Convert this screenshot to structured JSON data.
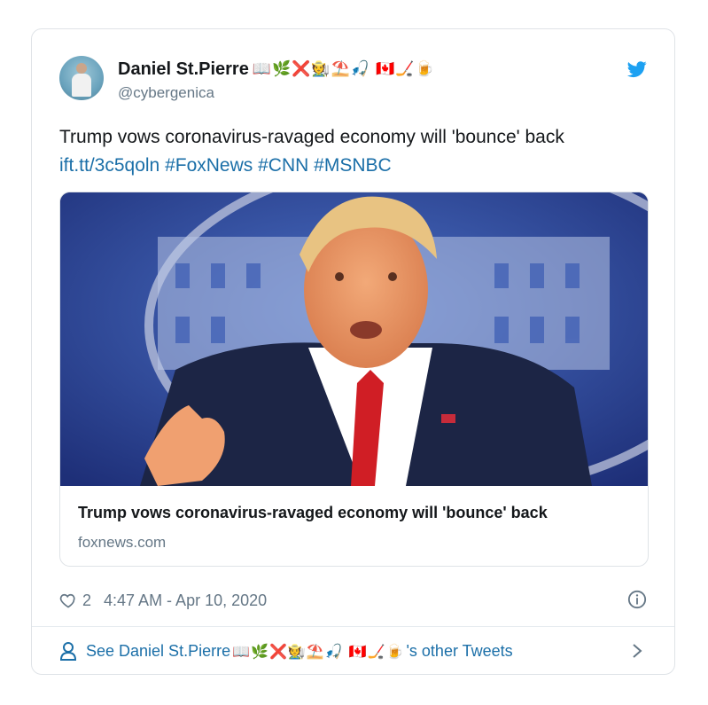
{
  "tweet": {
    "author_name": "Daniel St.Pierre",
    "author_emojis": "📖🌿❌🧑‍🌾⛱️🎣 🇨🇦🏒🍺",
    "handle": "@cybergenica",
    "text_line1": "Trump vows coronavirus-ravaged economy will 'bounce' back",
    "link": "ift.tt/3c5qoln",
    "hashtags": [
      "#FoxNews",
      "#CNN",
      "#MSNBC"
    ]
  },
  "card": {
    "title": "Trump vows coronavirus-ravaged economy will 'bounce' back",
    "domain": "foxnews.com"
  },
  "meta": {
    "likes": "2",
    "timestamp": "4:47 AM - Apr 10, 2020"
  },
  "footer": {
    "prefix": "See Daniel St.Pierre",
    "emojis": "📖🌿❌🧑‍🌾⛱️🎣 🇨🇦🏒🍺",
    "suffix": "'s other Tweets"
  },
  "colors": {
    "link": "#1b6fa8",
    "secondary": "#657786",
    "twitter_blue": "#1da1f2"
  },
  "icons": [
    "twitter-bird-icon",
    "heart-icon",
    "info-icon",
    "person-icon",
    "chevron-right-icon"
  ]
}
